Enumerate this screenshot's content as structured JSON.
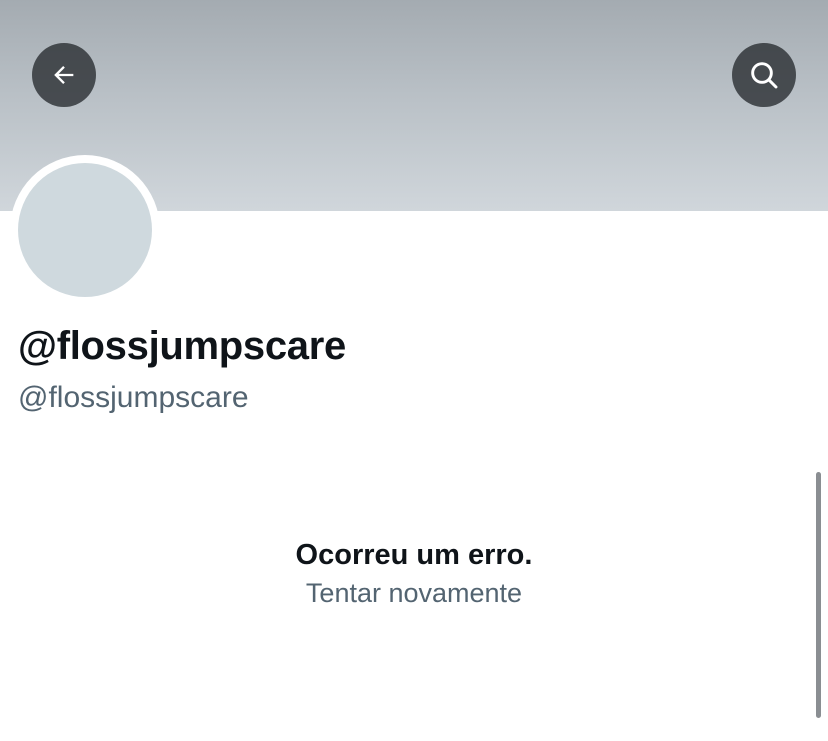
{
  "header": {
    "back_icon": "arrow-left-icon",
    "search_icon": "search-icon",
    "banner_colors": [
      "#a4abb1",
      "#d0d6db"
    ]
  },
  "profile": {
    "display_name": "@flossjumpscare",
    "handle": "@flossjumpscare",
    "avatar_color": "#cfd9de"
  },
  "error": {
    "message": "Ocorreu um erro.",
    "retry_label": "Tentar novamente"
  },
  "colors": {
    "primary_text": "#0f1419",
    "secondary_text": "#536471"
  }
}
